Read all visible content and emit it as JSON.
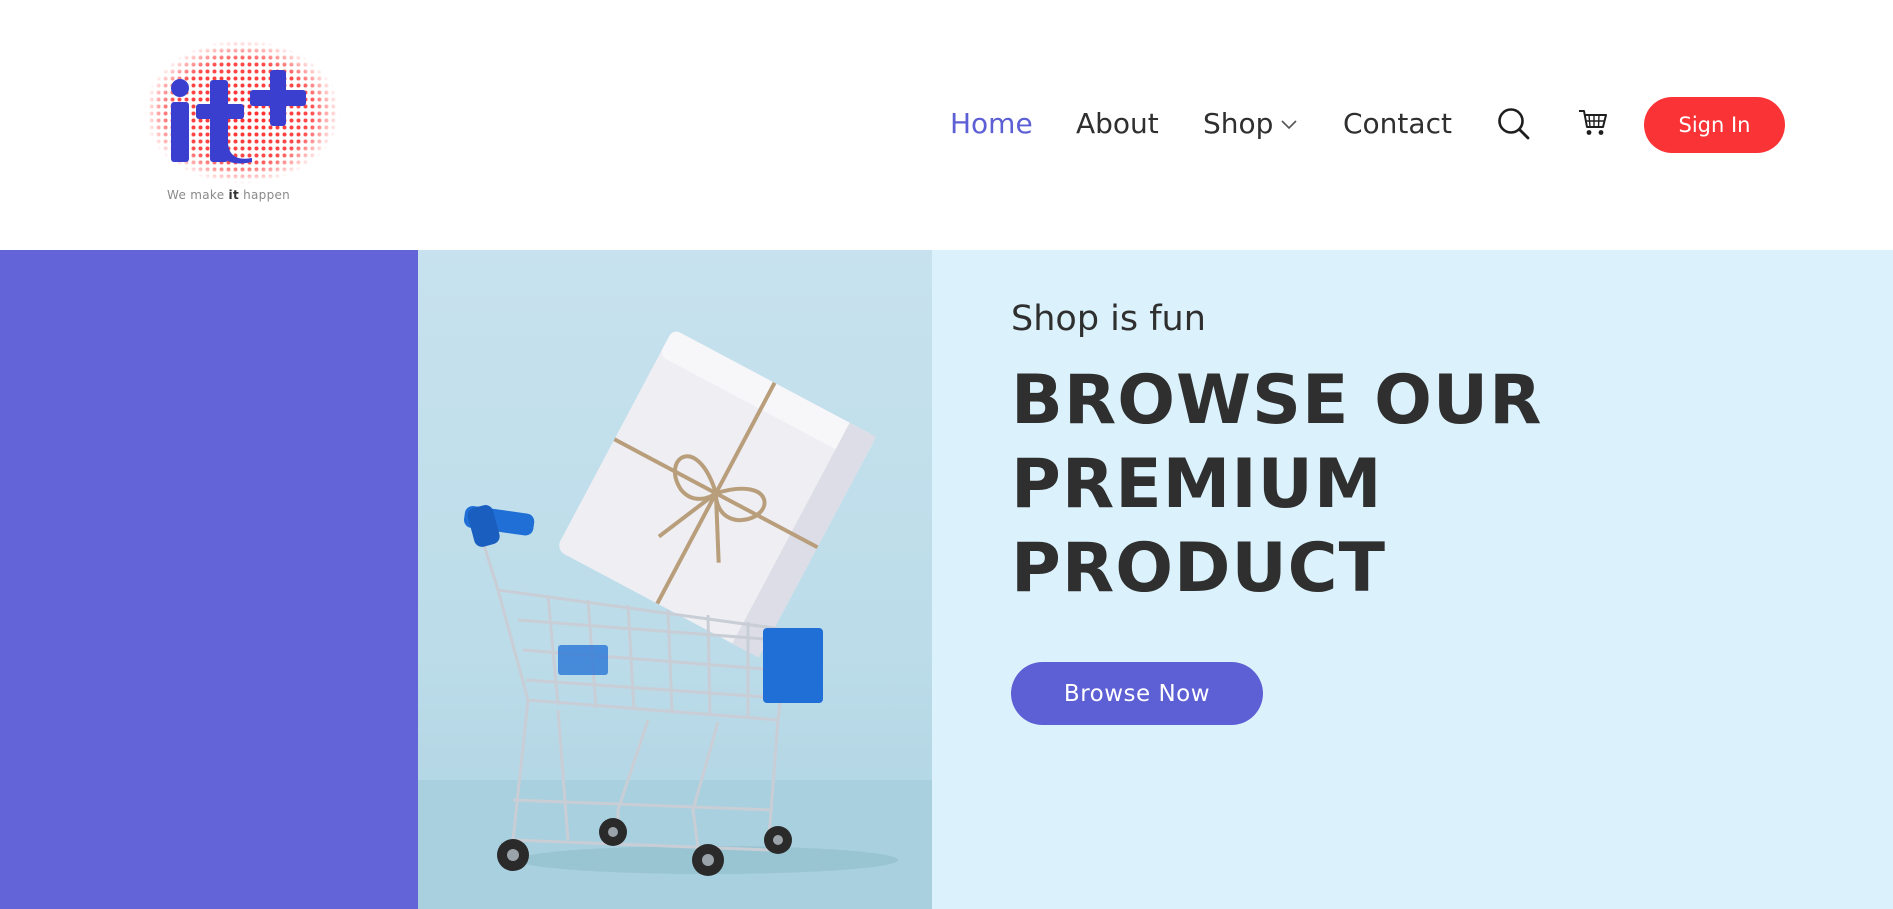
{
  "logo": {
    "text": "it+",
    "tagline_pre": "We make ",
    "tagline_bold": "it",
    "tagline_post": " happen"
  },
  "nav": {
    "items": [
      {
        "label": "Home",
        "active": true
      },
      {
        "label": "About",
        "active": false
      },
      {
        "label": "Shop",
        "active": false,
        "has_dropdown": true
      },
      {
        "label": "Contact",
        "active": false
      }
    ],
    "search_icon": "search-icon",
    "cart_icon": "cart-icon",
    "signin_label": "Sign In"
  },
  "hero": {
    "subtitle": "Shop is fun",
    "title": "BROWSE OUR PREMIUM PRODUCT",
    "button_label": "Browse Now"
  },
  "colors": {
    "accent": "#5d5fd4",
    "signin": "#fa3436",
    "hero_bg": "#dbf2fc",
    "hero_left": "#6264d8",
    "text_dark": "#2f2f2f"
  }
}
